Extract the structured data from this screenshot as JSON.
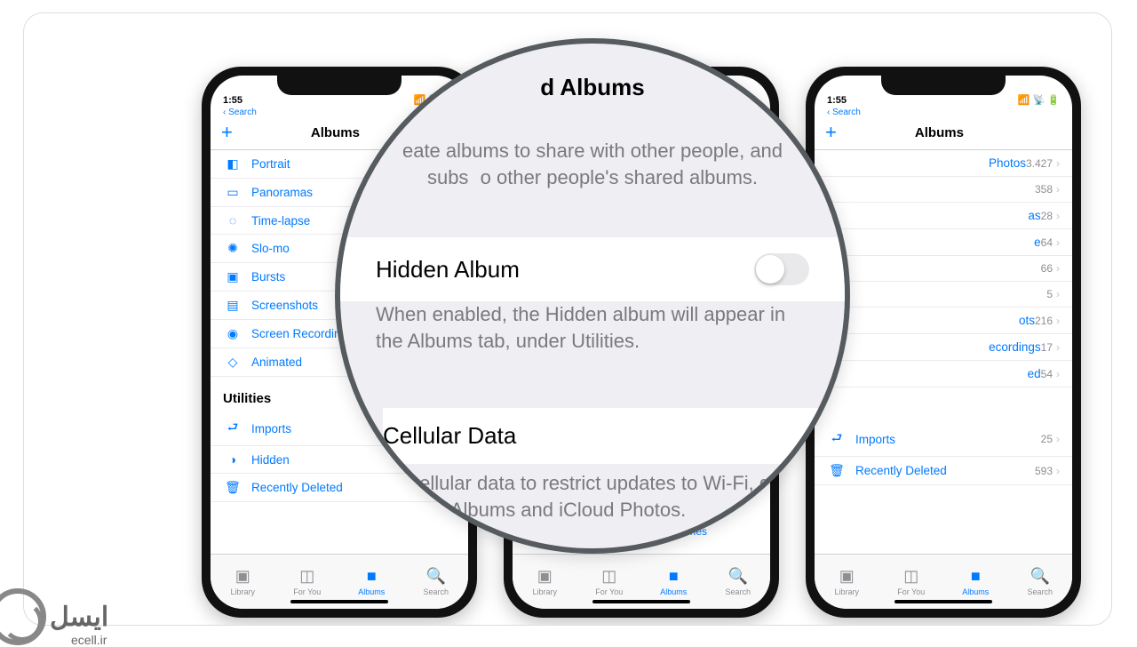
{
  "status": {
    "time": "1:55",
    "back_label": "Search"
  },
  "nav": {
    "title": "Albums",
    "plus": "+"
  },
  "mediaRows": [
    {
      "icon": "◧",
      "label": "Portrait"
    },
    {
      "icon": "▭",
      "label": "Panoramas"
    },
    {
      "icon": "◌",
      "label": "Time-lapse"
    },
    {
      "icon": "✺",
      "label": "Slo-mo"
    },
    {
      "icon": "▣",
      "label": "Bursts"
    },
    {
      "icon": "▤",
      "label": "Screenshots"
    },
    {
      "icon": "◉",
      "label": "Screen Recordings"
    },
    {
      "icon": "◇",
      "label": "Animated"
    }
  ],
  "utilHeader": "Utilities",
  "utilRows": [
    {
      "icon": "⮐",
      "label": "Imports",
      "count": ""
    },
    {
      "icon": "◑",
      "label": "Hidden",
      "count": ""
    },
    {
      "icon": "🗑",
      "label": "Recently Deleted",
      "count": "593"
    }
  ],
  "rightRows": [
    {
      "label": "Photos",
      "count": "3.427"
    },
    {
      "label": "",
      "count": "358"
    },
    {
      "label": "as",
      "count": "28"
    },
    {
      "label": "e",
      "count": "64"
    },
    {
      "label": "",
      "count": "66"
    },
    {
      "label": "",
      "count": "5"
    },
    {
      "label": "ots",
      "count": "216"
    },
    {
      "label": "ecordings",
      "count": "17"
    },
    {
      "label": "ed",
      "count": "54"
    }
  ],
  "rightUtil": [
    {
      "icon": "⮐",
      "label": "Imports",
      "count": "25"
    },
    {
      "icon": "🗑",
      "label": "Recently Deleted",
      "count": "593"
    }
  ],
  "settingsLink": "Reset Suggested Memories",
  "tabs": [
    {
      "icon": "▣",
      "label": "Library"
    },
    {
      "icon": "◫",
      "label": "For You"
    },
    {
      "icon": "■",
      "label": "Albums"
    },
    {
      "icon": "🔍",
      "label": "Search"
    }
  ],
  "lens": {
    "shared_title": "d Albums",
    "shared_desc": "eate albums to share with other people, and subs   o other people's shared albums.",
    "hidden_title": "Hidden Album",
    "hidden_desc": "When enabled, the Hidden album will appear in the Albums tab, under Utilities.",
    "cellular_title": "Cellular Data",
    "cellular_desc": "off cellular data to restrict updates to Wi-Fi, g Shared Albums and iCloud Photos."
  },
  "watermark": {
    "brand": "ایسل",
    "url": "ecell.ir"
  }
}
